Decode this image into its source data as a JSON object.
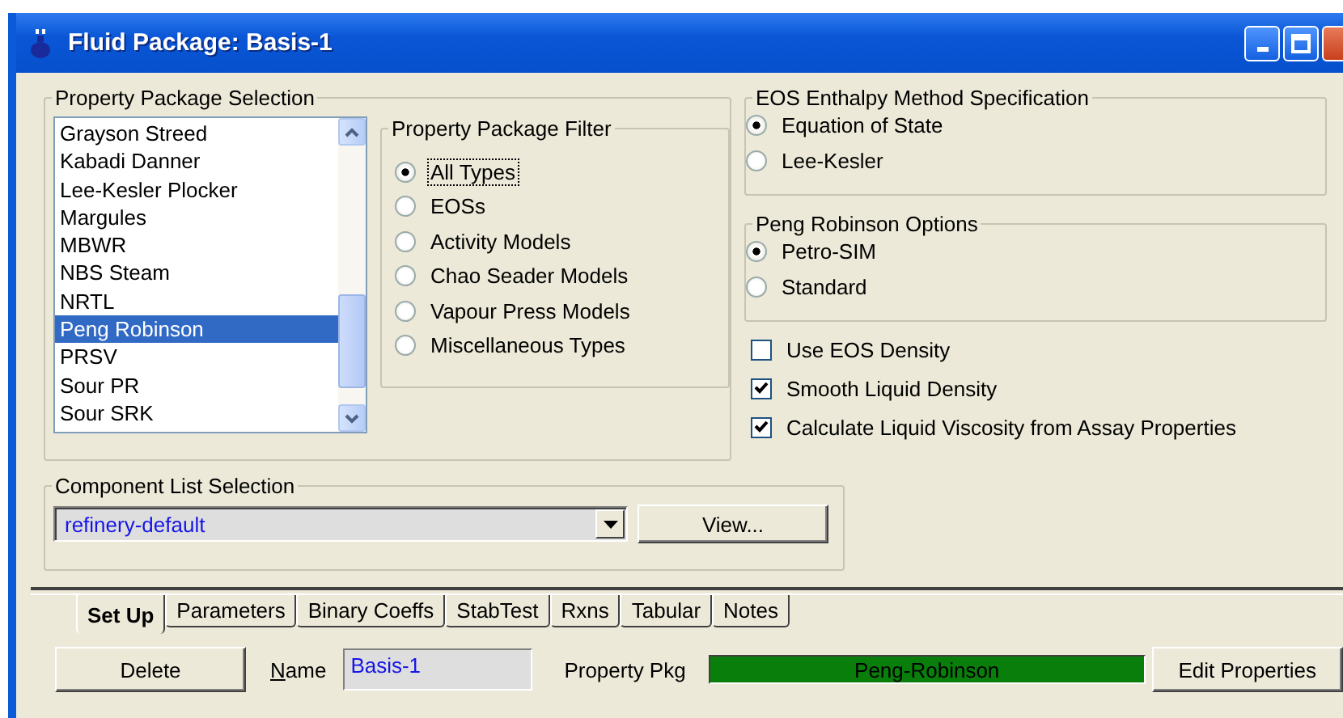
{
  "window": {
    "title": "Fluid Package: Basis-1"
  },
  "property_package_selection": {
    "title": "Property Package Selection",
    "packages": [
      {
        "name": "Grayson Streed",
        "selected": false
      },
      {
        "name": "Kabadi Danner",
        "selected": false
      },
      {
        "name": "Lee-Kesler Plocker",
        "selected": false
      },
      {
        "name": "Margules",
        "selected": false
      },
      {
        "name": "MBWR",
        "selected": false
      },
      {
        "name": "NBS Steam",
        "selected": false
      },
      {
        "name": "NRTL",
        "selected": false
      },
      {
        "name": "Peng Robinson",
        "selected": true
      },
      {
        "name": "PRSV",
        "selected": false
      },
      {
        "name": "Sour PR",
        "selected": false
      },
      {
        "name": "Sour SRK",
        "selected": false
      }
    ],
    "filter": {
      "title": "Property Package Filter",
      "options": [
        {
          "label": "All Types",
          "selected": true,
          "focused": true
        },
        {
          "label": "EOSs",
          "selected": false,
          "focused": false
        },
        {
          "label": "Activity Models",
          "selected": false,
          "focused": false
        },
        {
          "label": "Chao Seader Models",
          "selected": false,
          "focused": false
        },
        {
          "label": "Vapour Press Models",
          "selected": false,
          "focused": false
        },
        {
          "label": "Miscellaneous Types",
          "selected": false,
          "focused": false
        }
      ]
    }
  },
  "eos_enthalpy": {
    "title": "EOS Enthalpy Method Specification",
    "options": [
      {
        "label": "Equation of State",
        "selected": true
      },
      {
        "label": "Lee-Kesler",
        "selected": false
      }
    ]
  },
  "peng_robinson_options": {
    "title": "Peng Robinson Options",
    "options": [
      {
        "label": "Petro-SIM",
        "selected": true
      },
      {
        "label": "Standard",
        "selected": false
      }
    ]
  },
  "checkboxes": [
    {
      "label": "Use EOS Density",
      "checked": false
    },
    {
      "label": "Smooth Liquid Density",
      "checked": true
    },
    {
      "label": "Calculate Liquid Viscosity from Assay Properties",
      "checked": true
    }
  ],
  "component_list": {
    "title": "Component List Selection",
    "value": "refinery-default",
    "button": "View..."
  },
  "tabs": [
    {
      "label": "Set Up",
      "selected": true
    },
    {
      "label": "Parameters",
      "selected": false
    },
    {
      "label": "Binary Coeffs",
      "selected": false
    },
    {
      "label": "StabTest",
      "selected": false
    },
    {
      "label": "Rxns",
      "selected": false
    },
    {
      "label": "Tabular",
      "selected": false
    },
    {
      "label": "Notes",
      "selected": false
    }
  ],
  "bottom": {
    "delete_button": "Delete",
    "name_label": "Name",
    "name_value": "Basis-1",
    "property_pkg_label": "Property Pkg",
    "property_pkg_value": "Peng-Robinson",
    "edit_button": "Edit Properties"
  }
}
